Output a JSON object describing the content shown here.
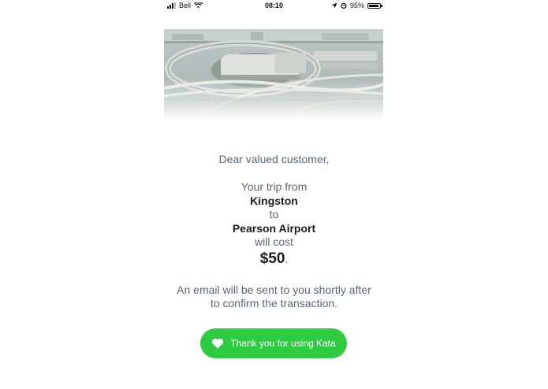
{
  "status_bar": {
    "carrier": "Bell",
    "time": "08:10",
    "battery": "95%",
    "battery_level": 0.95
  },
  "message": {
    "greeting": "Dear valued customer,",
    "line_trip_from": "Your trip from",
    "origin": "Kingston",
    "line_to": "to",
    "destination": "Pearson Airport",
    "line_will_cost": "will cost",
    "price": "$50",
    "price_suffix": ".",
    "note_line1": "An email will be sent to you shortly after",
    "note_line2": "to confirm the transaction."
  },
  "cta": {
    "label": "Thank you for using Kata",
    "icon": "heart-icon",
    "color": "#2ecc40"
  }
}
